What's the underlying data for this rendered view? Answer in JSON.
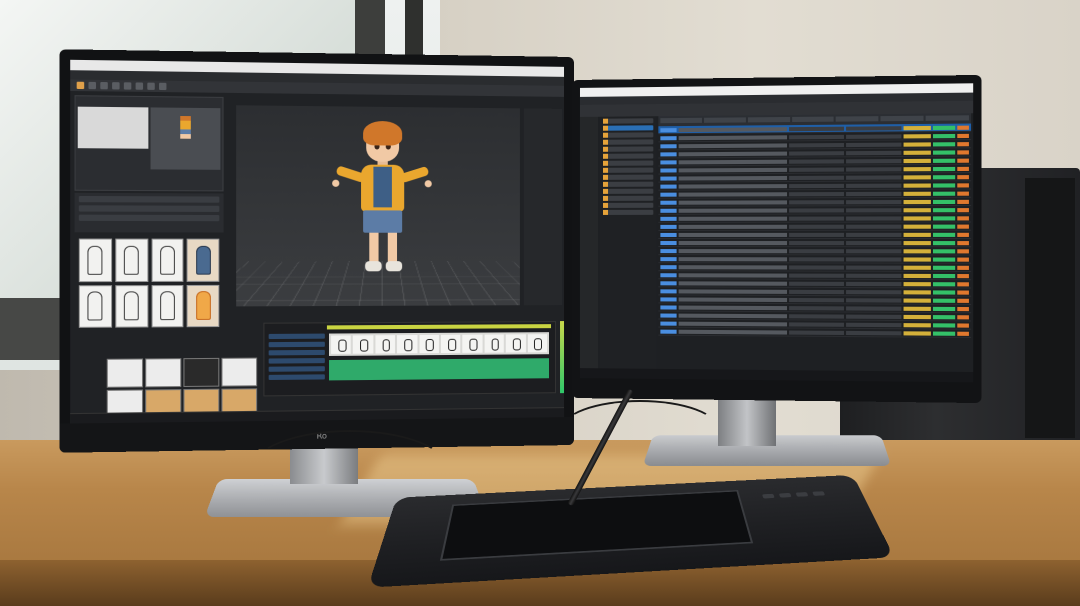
{
  "scene": {
    "left_monitor": {
      "brand": "Ro",
      "app": {
        "title_text": "",
        "viewport_label": ""
      }
    },
    "right_monitor": {
      "app": {
        "title_text": ""
      },
      "table_rows": 26
    }
  },
  "colors": {
    "accent_orange": "#eaa72e",
    "hair": "#d0772a",
    "selection_blue": "#1f5fa8",
    "timeline_green": "#2faa6a",
    "status_green": "#34c068",
    "status_yellow": "#d4b03a"
  }
}
